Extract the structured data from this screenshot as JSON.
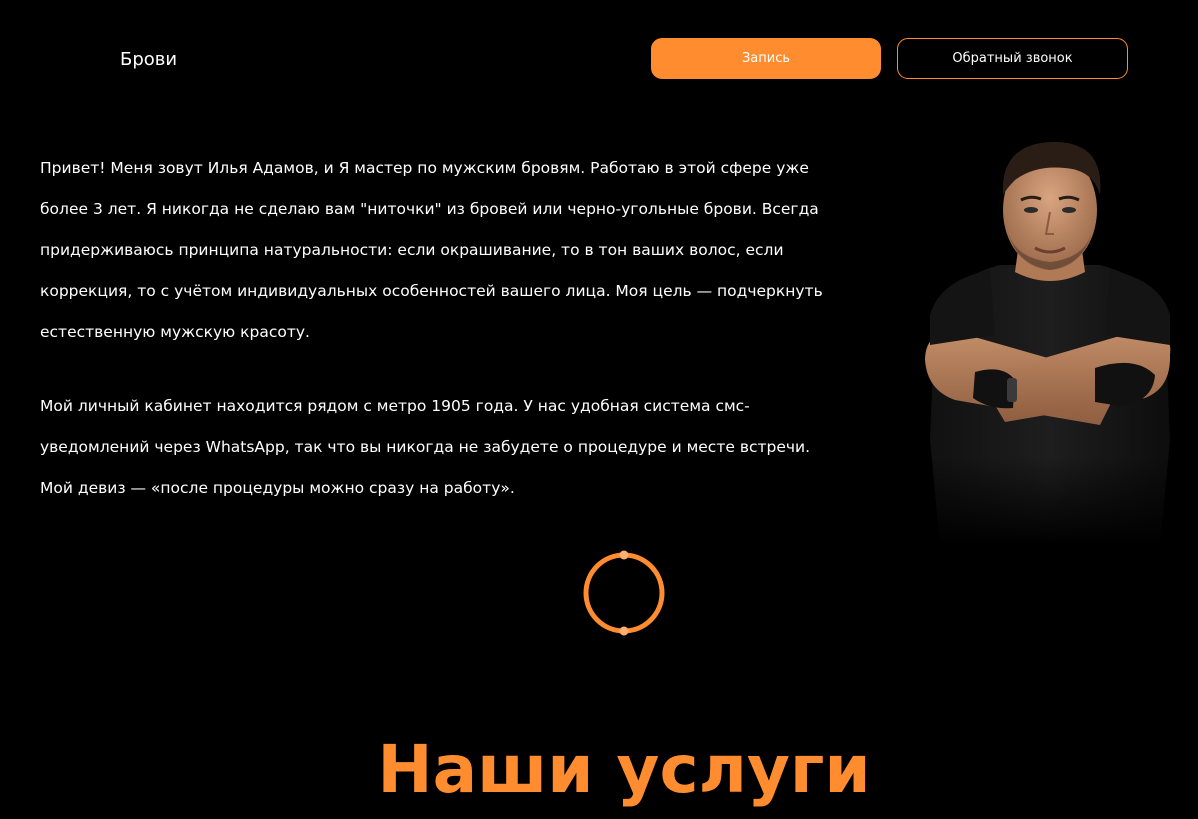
{
  "header": {
    "nav_link": "Брови",
    "primary_button": "Запись",
    "secondary_button": "Обратный звонок"
  },
  "about": {
    "paragraph_1": "Привет! Меня зовут Илья Адамов, и Я мастер по мужским бровям. Работаю в этой сфере уже более 3 лет. Я никогда не сделаю вам \"ниточки\" из бровей или черно-угольные брови. Всегда придерживаюсь принципа натуральности: если окрашивание, то в тон ваших волос, если коррекция, то с учётом индивидуальных особенностей вашего лица. Моя цель — подчеркнуть естественную мужскую красоту.",
    "paragraph_2": "Мой личный кабинет находится рядом с метро 1905 года. У нас удобная система смс-уведомлений через WhatsApp, так что вы никогда не забудете о процедуре и месте встречи. Мой девиз — «после процедуры можно сразу на работу»."
  },
  "services": {
    "title": "Наши услуги"
  },
  "colors": {
    "accent": "#ff8c2e",
    "background": "#000000",
    "text": "#ffffff"
  },
  "icons": {
    "loader": "loading-ring-icon"
  }
}
